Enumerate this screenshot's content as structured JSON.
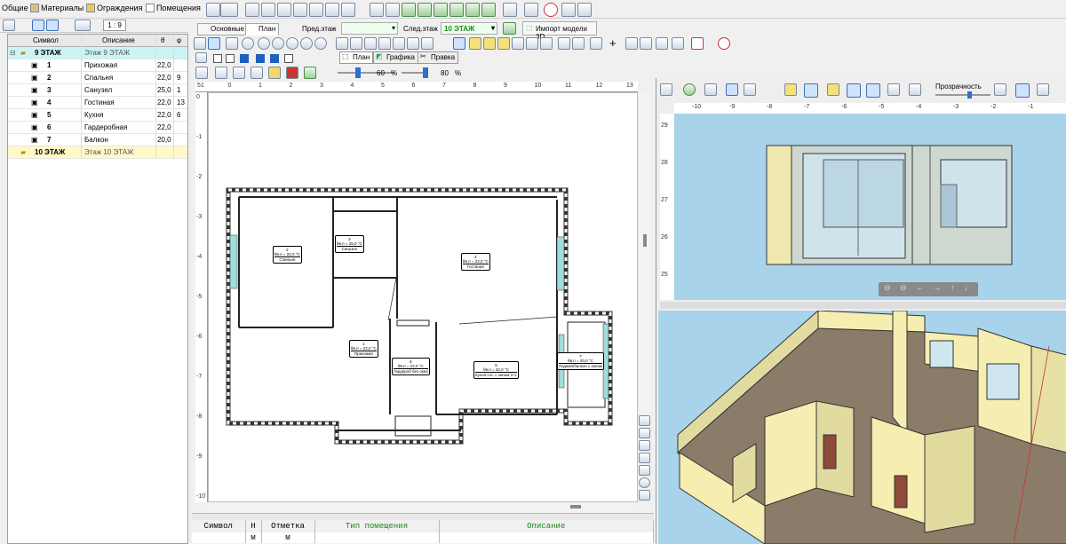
{
  "menu": {
    "general": "Общие",
    "materials": "Материалы",
    "barriers": "Ограждения",
    "rooms": "Помещения"
  },
  "tree": {
    "scale": "1 : 9",
    "col_symbol": "Символ",
    "col_desc": "Описание",
    "col_t": "θ",
    "col_f": "φ",
    "floors": [
      {
        "symbol": "9 ЭТАЖ",
        "desc": "Этаж 9 ЭТАЖ"
      },
      {
        "symbol": "10 ЭТАЖ",
        "desc": "Этаж 10 ЭТАЖ"
      }
    ],
    "rooms": [
      {
        "num": "1",
        "name": "Прихожая",
        "t": "22,0",
        "f": ""
      },
      {
        "num": "2",
        "name": "Спальня",
        "t": "22,0",
        "f": "9"
      },
      {
        "num": "3",
        "name": "Санузел",
        "t": "25,0",
        "f": "1"
      },
      {
        "num": "4",
        "name": "Гостиная",
        "t": "22,0",
        "f": "13"
      },
      {
        "num": "5",
        "name": "Кухня",
        "t": "22,0",
        "f": "6"
      },
      {
        "num": "6",
        "name": "Гардеробная",
        "t": "22,0",
        "f": ""
      },
      {
        "num": "7",
        "name": "Балкон",
        "t": "20,0",
        "f": ""
      }
    ]
  },
  "tabs": {
    "main": "Основные",
    "plan": "План"
  },
  "floor_nav": {
    "prev_label": "Пред.этаж",
    "next_label": "След.этаж",
    "next_value": "10 ЭТАЖ",
    "import": "Импорт модели 3D"
  },
  "view_tabs": {
    "plan": "План",
    "graphics": "Графика",
    "edit": "Правка"
  },
  "zoom": {
    "v1": "60",
    "unit1": "%",
    "v2": "80",
    "unit2": "%"
  },
  "plan": {
    "ruler_top": [
      "51",
      "0",
      "1",
      "2",
      "3",
      "4",
      "5",
      "6",
      "7",
      "8",
      "9",
      "10",
      "11",
      "12",
      "13"
    ],
    "ruler_left": [
      "0",
      "-1",
      "-2",
      "-3",
      "-4",
      "-5",
      "-6",
      "-7",
      "-8",
      "-9",
      "-10"
    ],
    "labels": [
      {
        "num": "2",
        "temp": "θв.п = 22,0 °C",
        "name": "Спальня"
      },
      {
        "num": "3",
        "temp": "θв.п = 25,0 °C",
        "name": "Санузел"
      },
      {
        "num": "4",
        "temp": "θв.п = 22,0 °C",
        "name": "Гостиная"
      },
      {
        "num": "1",
        "temp": "θв.п = 22,0 °C",
        "name": "Прихожая"
      },
      {
        "num": "6",
        "temp": "θв.п = 22,0 °C",
        "name": "Гардероб без окна"
      },
      {
        "num": "5",
        "temp": "θв.п = 22,0 °C",
        "name": "Кухня-гос. с окном 3 п."
      },
      {
        "num": "7",
        "temp": "θв.п = 20,0 °C",
        "name": "Лоджия/балкон с окном"
      }
    ]
  },
  "table": {
    "headers": [
      "Символ",
      "Н",
      "Отметка",
      "Тип помещения",
      "Описание"
    ],
    "units": [
      "",
      "м",
      "м",
      "",
      ""
    ]
  },
  "view3d": {
    "transparency": "Прозрачность",
    "ruler_x": [
      "-10",
      "-9",
      "-8",
      "-7",
      "-6",
      "-5",
      "-4",
      "-3",
      "-2",
      "-1"
    ],
    "ruler_y": [
      "29",
      "28",
      "27",
      "26",
      "25"
    ]
  },
  "colors": {
    "accent": "#1f5fbf",
    "wall3d": "#f5eeb0",
    "floor3d": "#8a7c68",
    "sky": "#a8d3ea"
  }
}
